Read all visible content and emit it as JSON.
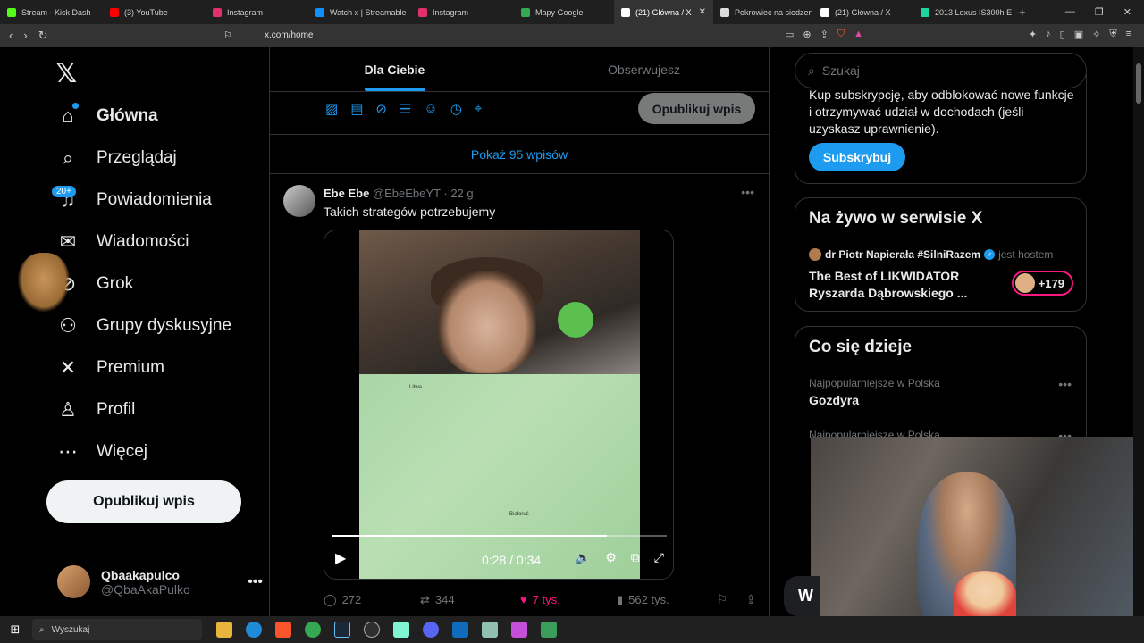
{
  "browser": {
    "tabs": [
      {
        "label": "Stream - Kick Dash",
        "color": "#53fc18"
      },
      {
        "label": "(3) YouTube",
        "color": "#ff0000"
      },
      {
        "label": "Instagram",
        "color": "#e1306c"
      },
      {
        "label": "Watch x | Streamable",
        "color": "#0f90fa"
      },
      {
        "label": "Instagram",
        "color": "#e1306c"
      },
      {
        "label": "Mapy Google",
        "color": "#34a853"
      },
      {
        "label": "(21) Główna / X",
        "color": "#ffffff",
        "active": true
      },
      {
        "label": "Pokrowiec na siedzeni",
        "color": "#dddddd"
      },
      {
        "label": "(21) Główna / X",
        "color": "#ffffff"
      },
      {
        "label": "2013 Lexus IS300h Eli",
        "color": "#1dd6a2"
      }
    ],
    "url": "x.com/home"
  },
  "nav": {
    "items": [
      {
        "label": "Główna",
        "icon": "home-icon",
        "glyph": "⌂"
      },
      {
        "label": "Przeglądaj",
        "icon": "search-icon",
        "glyph": "⌕"
      },
      {
        "label": "Powiadomienia",
        "icon": "bell-icon",
        "glyph": "♫"
      },
      {
        "label": "Wiadomości",
        "icon": "mail-icon",
        "glyph": "✉"
      },
      {
        "label": "Grok",
        "icon": "grok-icon",
        "glyph": "⊘"
      },
      {
        "label": "Grupy dyskusyjne",
        "icon": "communities-icon",
        "glyph": "⚇"
      },
      {
        "label": "Premium",
        "icon": "x-premium-icon",
        "glyph": "✕"
      },
      {
        "label": "Profil",
        "icon": "profile-icon",
        "glyph": "♙"
      },
      {
        "label": "Więcej",
        "icon": "more-icon",
        "glyph": "⋯"
      }
    ],
    "notifications_badge": "20+",
    "post_button": "Opublikuj wpis",
    "user": {
      "name": "Qbaakapulco",
      "handle": "@QbaAkaPulko"
    }
  },
  "feed": {
    "tabs": [
      "Dla Ciebie",
      "Obserwujesz"
    ],
    "composer_post": "Opublikuj wpis",
    "show_posts": "Pokaż 95 wpisów",
    "post": {
      "name": "Ebe Ebe",
      "handle": "@EbeEbeYT",
      "time": "· 22 g.",
      "text": "Takich strategów potrzebujemy",
      "video_time": "0:28 / 0:34",
      "progress": 0.82,
      "map_labels": [
        "Litwa",
        "Białoruś"
      ],
      "replies": "272",
      "reposts": "344",
      "likes": "7 tys.",
      "views": "562 tys."
    }
  },
  "right": {
    "search_placeholder": "Szukaj",
    "premium_text": "Kup subskrypcję, aby odblokować nowe funkcje i otrzymywać udział w dochodach (jeśli uzyskasz uprawnienie).",
    "premium_button": "Subskrybuj",
    "live": {
      "heading": "Na żywo w serwisie X",
      "host_name": "dr Piotr Napierała #SilniRazem",
      "host_suffix": "jest hostem",
      "title": "The Best of LIKWIDATOR Ryszarda Dąbrowskiego ...",
      "listeners": "+179"
    },
    "trends": {
      "heading": "Co się dzieje",
      "items": [
        {
          "context": "Najpopularniejsze w Polska",
          "name": "Gozdyra"
        },
        {
          "context": "Najpopularniejsze w Polska",
          "name": ""
        }
      ]
    }
  },
  "taskbar": {
    "search": "Wyszukaj"
  },
  "colors": {
    "accent": "#1d9bf0",
    "like": "#f91880",
    "border": "#2f3336",
    "muted": "#71767b"
  }
}
